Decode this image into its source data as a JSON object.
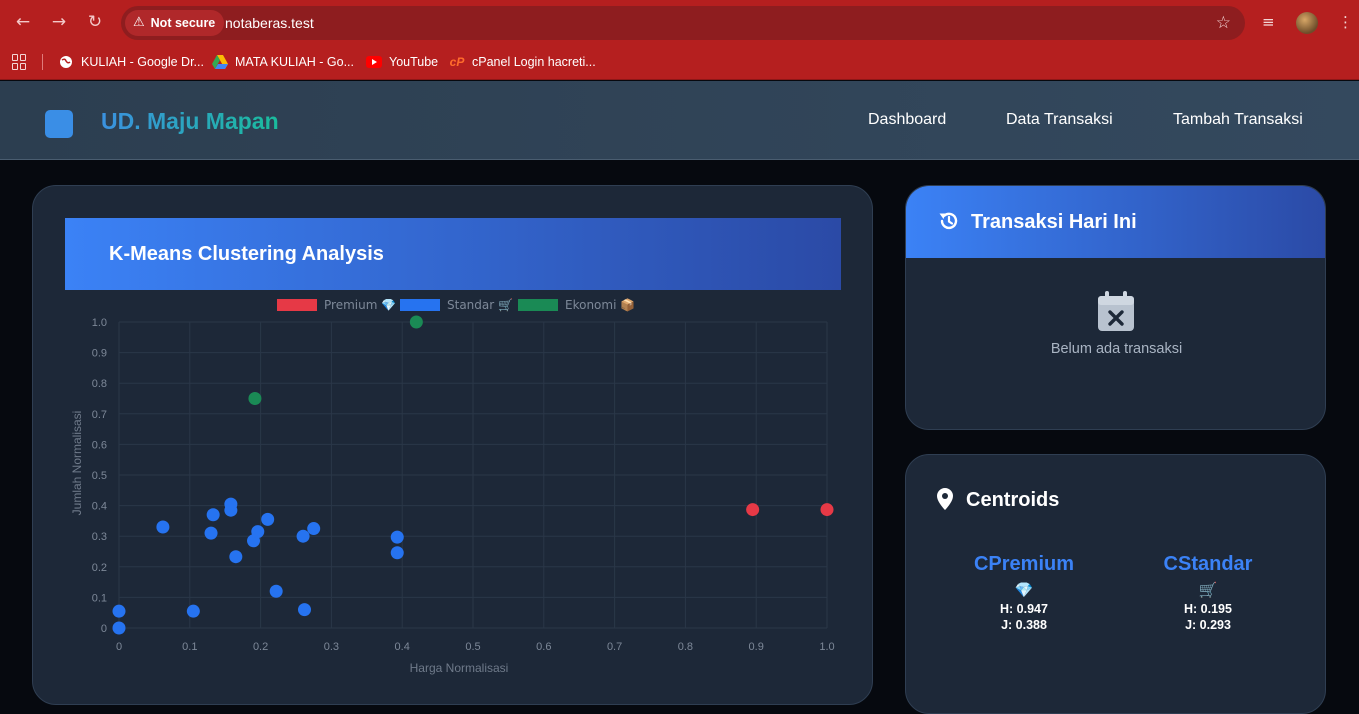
{
  "browser": {
    "security_label": "Not secure",
    "url": "notaberas.test",
    "bookmarks": [
      {
        "label": "KULIAH - Google Dr...",
        "icon": "globe-icon"
      },
      {
        "label": "MATA KULIAH - Go...",
        "icon": "google-drive-icon"
      },
      {
        "label": "YouTube",
        "icon": "youtube-icon"
      },
      {
        "label": "cPanel Login hacreti...",
        "icon": "cpanel-icon"
      }
    ]
  },
  "header": {
    "brand": "UD. Maju Mapan",
    "nav": [
      "Dashboard",
      "Data Transaksi",
      "Tambah Transaksi"
    ]
  },
  "chart_card": {
    "title": "K-Means Clustering Analysis"
  },
  "chart_data": {
    "type": "scatter",
    "title": "",
    "xlabel": "Harga Normalisasi",
    "ylabel": "Jumlah Normalisasi",
    "xlim": [
      0,
      1
    ],
    "ylim": [
      0,
      1
    ],
    "x_ticks": [
      "0",
      "0.1",
      "0.2",
      "0.3",
      "0.4",
      "0.5",
      "0.6",
      "0.7",
      "0.8",
      "0.9",
      "1.0"
    ],
    "y_ticks": [
      "0",
      "0.1",
      "0.2",
      "0.3",
      "0.4",
      "0.5",
      "0.6",
      "0.7",
      "0.8",
      "0.9",
      "1.0"
    ],
    "grid": true,
    "legend_position": "top",
    "series": [
      {
        "name": "Premium 💎",
        "color": "#e63946",
        "points": [
          [
            0.895,
            0.387
          ],
          [
            1.0,
            0.387
          ]
        ]
      },
      {
        "name": "Standar 🛒",
        "color": "#2673f0",
        "points": [
          [
            0.0,
            0.055
          ],
          [
            0.0,
            0.0
          ],
          [
            0.062,
            0.33
          ],
          [
            0.105,
            0.055
          ],
          [
            0.13,
            0.31
          ],
          [
            0.133,
            0.37
          ],
          [
            0.158,
            0.405
          ],
          [
            0.158,
            0.385
          ],
          [
            0.165,
            0.233
          ],
          [
            0.19,
            0.285
          ],
          [
            0.196,
            0.315
          ],
          [
            0.21,
            0.355
          ],
          [
            0.222,
            0.12
          ],
          [
            0.26,
            0.3
          ],
          [
            0.262,
            0.06
          ],
          [
            0.275,
            0.325
          ],
          [
            0.393,
            0.297
          ],
          [
            0.393,
            0.246
          ]
        ]
      },
      {
        "name": "Ekonomi 📦",
        "color": "#1a8a55",
        "points": [
          [
            0.192,
            0.75
          ],
          [
            0.42,
            1.0
          ]
        ]
      }
    ]
  },
  "transaksi_card": {
    "title": "Transaksi Hari Ini",
    "empty_text": "Belum ada transaksi"
  },
  "centroids_card": {
    "title": "Centroids",
    "items": [
      {
        "name": "CPremium",
        "emoji": "💎",
        "h": "H: 0.947",
        "j": "J: 0.388"
      },
      {
        "name": "CStandar",
        "emoji": "🛒",
        "h": "H: 0.195",
        "j": "J: 0.293"
      }
    ]
  }
}
